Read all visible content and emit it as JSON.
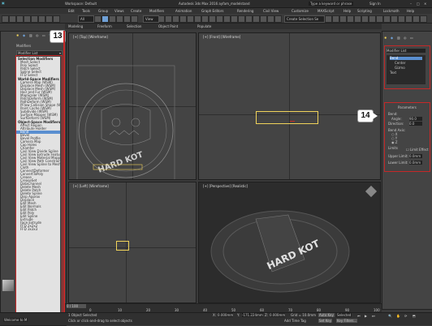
{
  "app": {
    "title": "Autodesk 3ds Max 2016   ayfam_modelstand",
    "workspace": "Workspace: Default",
    "sign_in": "Sign In",
    "search_placeholder": "Type a keyword or phrase"
  },
  "menu": [
    "Edit",
    "Tools",
    "Group",
    "Views",
    "Create",
    "Modifiers",
    "Animation",
    "Graph Editors",
    "Rendering",
    "Civil View",
    "Customize",
    "MAXScript",
    "Help",
    "Scripting",
    "Lockmath",
    "Help"
  ],
  "toolbar": {
    "selection_filter": "All",
    "view_dropdown": "View",
    "named_selection": "Create Selection Se"
  },
  "ribbon": {
    "items": [
      "Modeling",
      "Freeform",
      "Selection",
      "Object Paint",
      "Populate"
    ]
  },
  "left_panel": {
    "callout": "13",
    "modifier_list_label": "Modifier List",
    "title": "Modifiers",
    "sections": [
      {
        "header": "Selection Modifiers",
        "items": [
          "Mesh Select",
          "Poly Select",
          "Patch Select",
          "Spline Select",
          "FFD Select"
        ]
      },
      {
        "header": "World-Space Modifiers",
        "items": [
          "Camera Map (WSM)",
          "Displace Mesh (WSM)",
          "Displace Mesh (WSM)",
          "Hair and Fur (WSM)",
          "MapScaler (WSM)",
          "PatchDeform (WSM)",
          "PathDeform (WSM)",
          "PFlow Collision Shape (WSM)",
          "Point Cache (WSM)",
          "Subdivide (WSM)",
          "Surface Mapper (WSM)",
          "SurfDeform (WSM)"
        ]
      },
      {
        "header": "Object-Space Modifiers",
        "items": [
          "Affect Region",
          "Attribute Holder",
          "Bend",
          "Bevel",
          "Bevel Profile",
          "Camera Map",
          "Cap Holes",
          "Chamfer",
          "Civil View Divide Spline",
          "Civil View Extrude Feature",
          "Civil View Material Mapper",
          "Civil View Path Constraint",
          "Civil View Spline to Mesh",
          "Cloth",
          "ConnectDeformer",
          "ConvertToPoly",
          "Crease",
          "CreaseSet",
          "DataChannel",
          "Delete Mesh",
          "Delete Patch",
          "Delete Spline",
          "Disp Approx",
          "Displace",
          "Edit Mesh",
          "Edit Normals",
          "Edit Patch",
          "Edit Poly",
          "Edit Spline",
          "Extrude",
          "Face Extrude",
          "FFD 2x2x2",
          "FFD 3x3x3"
        ]
      }
    ],
    "selected_item": "Bend"
  },
  "viewports": {
    "top": "[+] [Top] [Wireframe]",
    "front": "[+] [Front] [Wireframe]",
    "left": "[+] [Left] [Wireframe]",
    "perspective": "[+] [Perspective] [Realistic]",
    "logo_text": "HARD KOT"
  },
  "right_panel": {
    "callout": "14",
    "title": "Modifier List",
    "stack": [
      "Bend",
      "Center",
      "Gizmo",
      "Text"
    ],
    "rollout_title": "Parameters",
    "bend_group": "Bend:",
    "angle_label": "Angle:",
    "angle_value": "90.0",
    "direction_label": "Direction:",
    "direction_value": "0.0",
    "bend_axis_label": "Bend Axis:",
    "axes": [
      "X",
      "Y",
      "Z"
    ],
    "limits_label": "Limits",
    "limit_effect": "Limit Effect",
    "upper_label": "Upper Limit:",
    "upper_value": "0.0mm",
    "lower_label": "Lower Limit:",
    "lower_value": "0.0mm"
  },
  "timeline": {
    "frame_display": "0 / 100",
    "ticks": [
      "0",
      "10",
      "20",
      "30",
      "40",
      "50",
      "60",
      "70",
      "80",
      "90",
      "100"
    ]
  },
  "status": {
    "selection": "1 Object Selected",
    "hint": "Click or click-and-drag to select objects",
    "welcome": "Welcome to M",
    "x_label": "X:",
    "x_value": "0.000mm",
    "y_label": "Y:",
    "y_value": "-171.224mm",
    "z_label": "Z:",
    "z_value": "0.000mm",
    "grid": "Grid = 10.0mm",
    "auto_key": "Auto Key",
    "selected": "Selected",
    "set_key": "Set Key",
    "key_filters": "Key Filters...",
    "add_time_tag": "Add Time Tag"
  },
  "colors": {
    "accent": "#6fa0d6",
    "highlight": "#c62828",
    "selection": "#f0d35a"
  }
}
